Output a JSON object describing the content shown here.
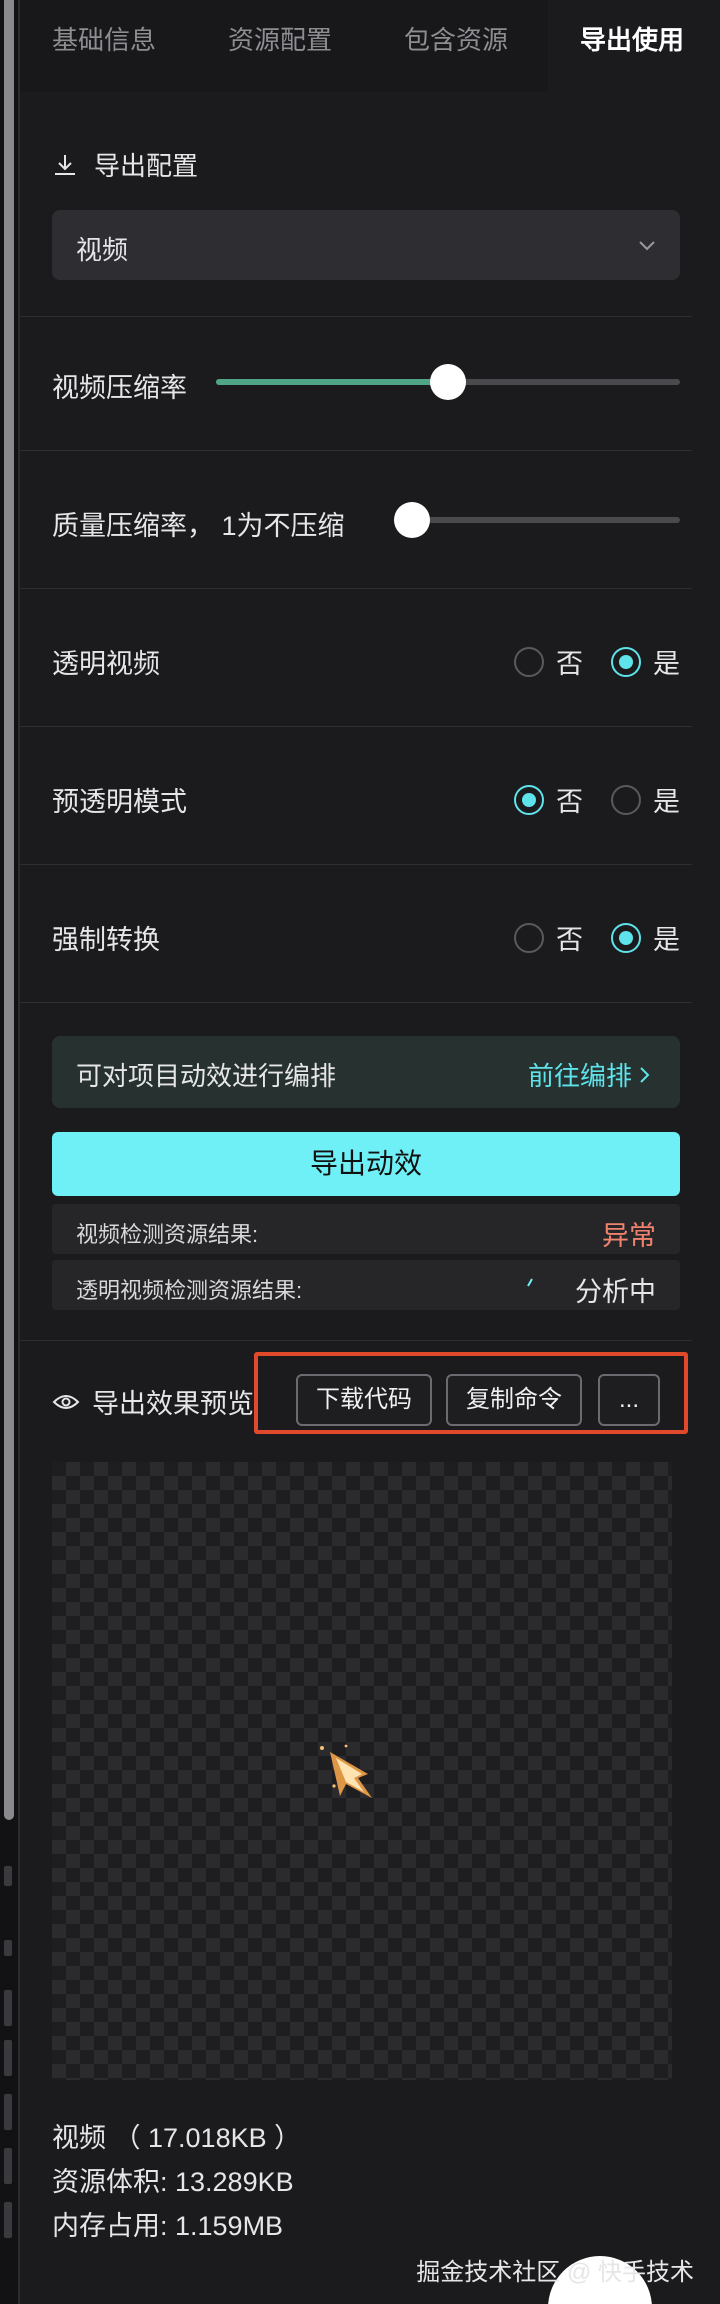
{
  "tabs": [
    {
      "label": "基础信息",
      "active": false
    },
    {
      "label": "资源配置",
      "active": false
    },
    {
      "label": "包含资源",
      "active": false
    },
    {
      "label": "导出使用",
      "active": true
    }
  ],
  "export_config": {
    "title": "导出配置",
    "icon": "download-icon",
    "format_selected": "视频"
  },
  "settings": {
    "video_compression": {
      "label": "视频压缩率",
      "value": 0.5
    },
    "quality_compression": {
      "label": "质量压缩率，  1为不压缩",
      "value": 0
    },
    "transparent_video": {
      "label": "透明视频",
      "no": "否",
      "yes": "是",
      "selected": "是"
    },
    "premultiplied_alpha": {
      "label": "预透明模式",
      "no": "否",
      "yes": "是",
      "selected": "否"
    },
    "force_convert": {
      "label": "强制转换",
      "no": "否",
      "yes": "是",
      "selected": "是"
    }
  },
  "arrange": {
    "text": "可对项目动效进行编排",
    "link": "前往编排"
  },
  "export_button": "导出动效",
  "results": [
    {
      "label": "视频检测资源结果:",
      "value": "异常",
      "color": "#f0826e"
    },
    {
      "label": "透明视频检测资源结果:",
      "value": "分析中",
      "color": "#e6e6e8"
    }
  ],
  "preview": {
    "title": "导出效果预览",
    "buttons": {
      "download_code": "下载代码",
      "copy_command": "复制命令",
      "more": "..."
    }
  },
  "file_info": {
    "format_line": "视频 （ 17.018KB ）",
    "size_line": "资源体积: 13.289KB",
    "memory_line": "内存占用: 1.159MB"
  },
  "watermark": "掘金技术社区 @ 快手技术",
  "colors": {
    "accent": "#6ef0f6",
    "slider_fill": "#4fa585",
    "highlight_border": "#e04a2a",
    "error": "#f0826e"
  }
}
